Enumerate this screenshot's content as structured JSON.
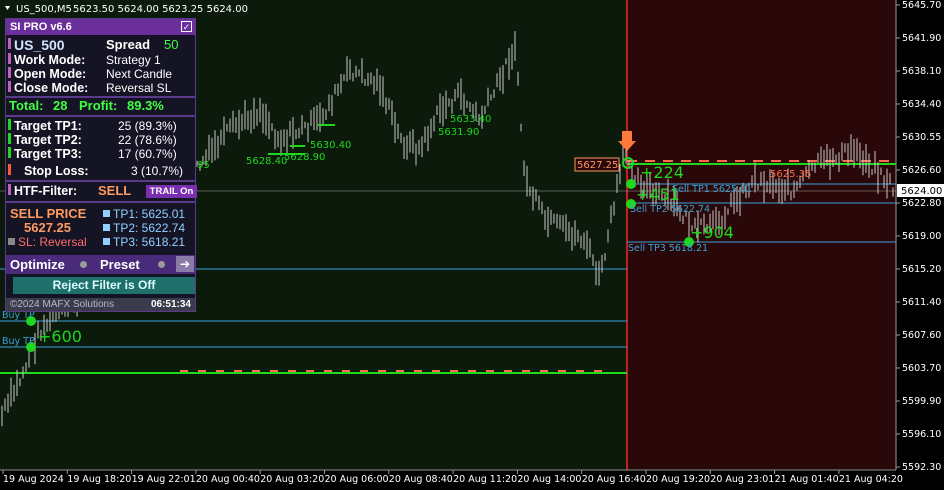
{
  "window": {
    "symbol": "US_500,M5",
    "ohlc": "5623.50 5624.00 5623.25 5624.00"
  },
  "panel": {
    "title": "SI PRO v6.6",
    "symbol": "US_500",
    "spread_label": "Spread",
    "spread_value": "50",
    "work_mode_label": "Work  Mode:",
    "work_mode_value": "Strategy 1",
    "open_mode_label": "Open  Mode:",
    "open_mode_value": "Next Candle",
    "close_mode_label": "Close Mode:",
    "close_mode_value": "Reversal SL",
    "total_label": "Total:",
    "total_value": "28",
    "profit_label": "Profit:",
    "profit_value": "89.3%",
    "tp1_label": "Target TP1:",
    "tp1_value": "25 (89.3%)",
    "tp2_label": "Target TP2:",
    "tp2_value": "22 (78.6%)",
    "tp3_label": "Target TP3:",
    "tp3_value": "17 (60.7%)",
    "sl_label": "Stop Loss:",
    "sl_value": "3 (10.7%)",
    "htf_label": "HTF-Filter:",
    "htf_value": "SELL",
    "trail_label": "TRAIL On",
    "sell_price_label": "SELL PRICE",
    "sell_price_value": "5627.25",
    "sl_mode": "SL: Reversal",
    "tp1_price": "TP1: 5625.01",
    "tp2_price": "TP2: 5622.74",
    "tp3_price": "TP3: 5618.21",
    "optimize_label": "Optimize",
    "preset_label": "Preset",
    "arrow_label": "➔",
    "reject_label": "Reject Filter is Off",
    "copyright": "©2024 MAFX Solutions",
    "timer": "06:51:34"
  },
  "price_axis": {
    "ticks": [
      "5645.70",
      "5641.90",
      "5638.10",
      "5634.40",
      "5630.55",
      "5626.60",
      "5622.80",
      "5619.00",
      "5615.20",
      "5611.40",
      "5607.60",
      "5603.70",
      "5599.90",
      "5596.10",
      "5592.30"
    ],
    "current_price": "5624.00"
  },
  "time_axis": {
    "ticks": [
      "19 Aug 2024",
      "19 Aug 18:20",
      "19 Aug 22:01",
      "20 Aug 00:40",
      "20 Aug 03:20",
      "20 Aug 06:00",
      "20 Aug 08:40",
      "20 Aug 11:20",
      "20 Aug 14:00",
      "20 Aug 16:40",
      "20 Aug 19:20",
      "20 Aug 23:01",
      "21 Aug 01:40",
      "21 Aug 04:20"
    ]
  },
  "annotations": {
    "entry_price": "5627.25",
    "sl_price": "5625.35",
    "tp1_line": "Sell TP1 5625.01",
    "tp2_line": "Sell TP2 5622.74",
    "tp3_line": "Sell TP3 5618.21",
    "points_a": "+224",
    "points_b": "+451",
    "points_c": "+904",
    "prev_a": "5628.40",
    "prev_b": "5628.90",
    "prev_c": "5630.40",
    "prev_d": "5633.40",
    "prev_e": "5631.90",
    "buy_tp": "Buy TP",
    "buy_tp2": "Buy TP",
    "buy_pts": "+600",
    "left_tag": "95"
  },
  "colors": {
    "bg_past": "#0b1a0b",
    "bg_active": "#2a0708",
    "candle": "#c8c8c8",
    "accent_green": "#1fd71f",
    "accent_red": "#ff6a4a",
    "tp_line": "#3aa0d8"
  }
}
